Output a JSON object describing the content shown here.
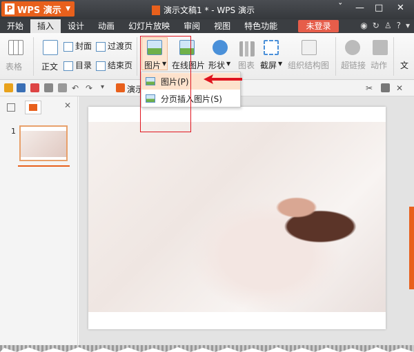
{
  "app": {
    "name": "WPS 演示",
    "doc_title": "演示文稿1 * - WPS 演示"
  },
  "window_controls": [
    "ˇ",
    "—",
    "□",
    "✕"
  ],
  "menu": {
    "items": [
      "开始",
      "插入",
      "设计",
      "动画",
      "幻灯片放映",
      "审阅",
      "视图",
      "特色功能"
    ],
    "active": "插入",
    "login": "未登录"
  },
  "ribbon": {
    "table": "表格",
    "body_text": "正文",
    "cover": "封面",
    "toc": "目录",
    "transition_page": "过渡页",
    "end_page": "结束页",
    "picture": "图片",
    "online_picture": "在线图片",
    "shapes": "形状",
    "chart": "图表",
    "screenshot": "截屏",
    "org_chart": "组织结构图",
    "hyperlink": "超链接",
    "action": "动作",
    "text": "文"
  },
  "dropdown": {
    "items": [
      "图片(P)",
      "分页插入图片(S)"
    ]
  },
  "qat": {
    "tab_label": "演示"
  },
  "panel": {
    "slide_number": "1",
    "close": "✕"
  },
  "colors": {
    "accent": "#e8601c",
    "highlight_box": "#e0141e",
    "hover": "#fde2cc"
  }
}
